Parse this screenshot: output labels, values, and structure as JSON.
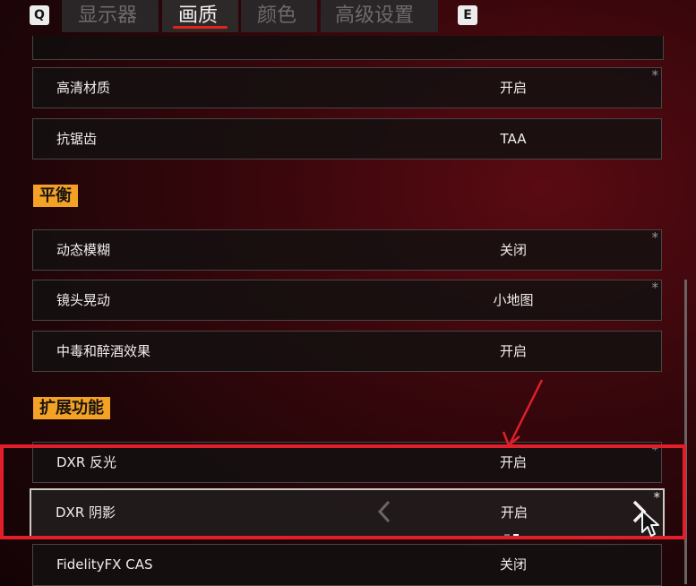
{
  "tabs": {
    "left_key": "Q",
    "right_key": "E",
    "items": [
      {
        "label": "显示器"
      },
      {
        "label": "画质"
      },
      {
        "label": "颜色"
      },
      {
        "label": "高级设置"
      }
    ],
    "active_index": 1
  },
  "settings": {
    "hd_textures": {
      "label": "高清材质",
      "value": "开启",
      "star": "*"
    },
    "anti_aliasing": {
      "label": "抗锯齿",
      "value": "TAA"
    },
    "balance_heading": "平衡",
    "motion_blur": {
      "label": "动态模糊",
      "value": "关闭",
      "star": "*"
    },
    "camera_shake": {
      "label": "镜头晃动",
      "value": "小地图",
      "star": "*"
    },
    "poison_drunk": {
      "label": "中毒和醉酒效果",
      "value": "开启"
    },
    "extended_heading": "扩展功能",
    "dxr_reflections": {
      "label": "DXR 反光",
      "value": "开启",
      "star": "*"
    },
    "dxr_shadows": {
      "label": "DXR 阴影",
      "value": "开启",
      "star": "*"
    },
    "fidelityfx_cas": {
      "label": "FidelityFX CAS",
      "value": "关闭"
    }
  },
  "colors": {
    "accent_red": "#e01f2a",
    "section_orange": "#f4a226",
    "tab_underline": "#e2231a"
  },
  "icons": [
    "chevron-left-icon",
    "chevron-right-icon",
    "mouse-cursor-icon"
  ]
}
